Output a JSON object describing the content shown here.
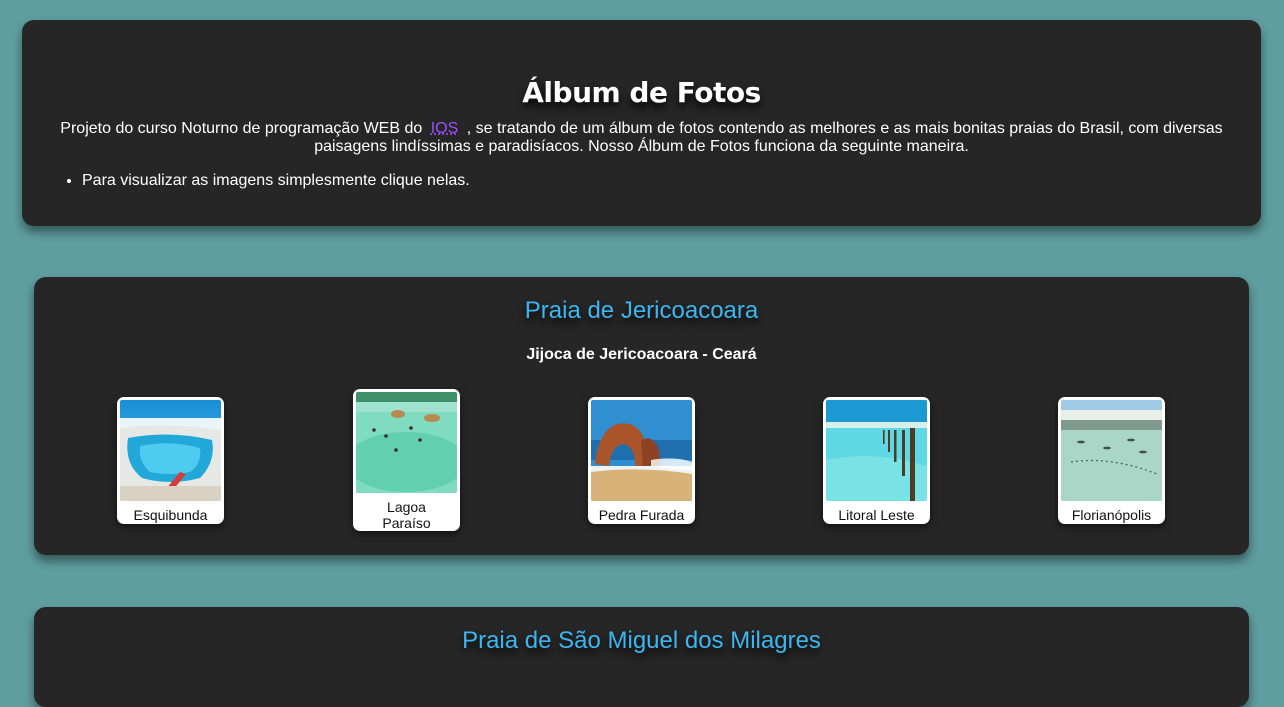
{
  "header": {
    "title": "Álbum de Fotos",
    "intro_before": "Projeto do curso Noturno de programação WEB do",
    "intro_link": "IOS",
    "intro_after": ", se tratando de um álbum de fotos contendo as melhores e as mais bonitas praias do Brasil, com diversas paisagens lindíssimas e paradisíacos. Nosso Álbum de Fotos funciona da seguinte maneira.",
    "instructions": [
      "Para visualizar as imagens simplesmente clique nelas."
    ]
  },
  "sections": [
    {
      "title": "Praia de Jericoacoara",
      "subtitle": "Jijoca de Jericoacoara - Ceará",
      "photos": [
        {
          "caption": "Esquibunda",
          "icon": "beach-dune-lagoon-photo"
        },
        {
          "caption": "Lagoa Paraíso",
          "icon": "lagoon-hammocks-photo"
        },
        {
          "caption": "Pedra Furada",
          "icon": "rock-arch-photo"
        },
        {
          "caption": "Litoral Leste",
          "icon": "coast-posts-photo"
        },
        {
          "caption": "Florianópolis",
          "icon": "beach-boats-photo"
        }
      ]
    },
    {
      "title": "Praia de São Miguel dos Milagres"
    }
  ]
}
